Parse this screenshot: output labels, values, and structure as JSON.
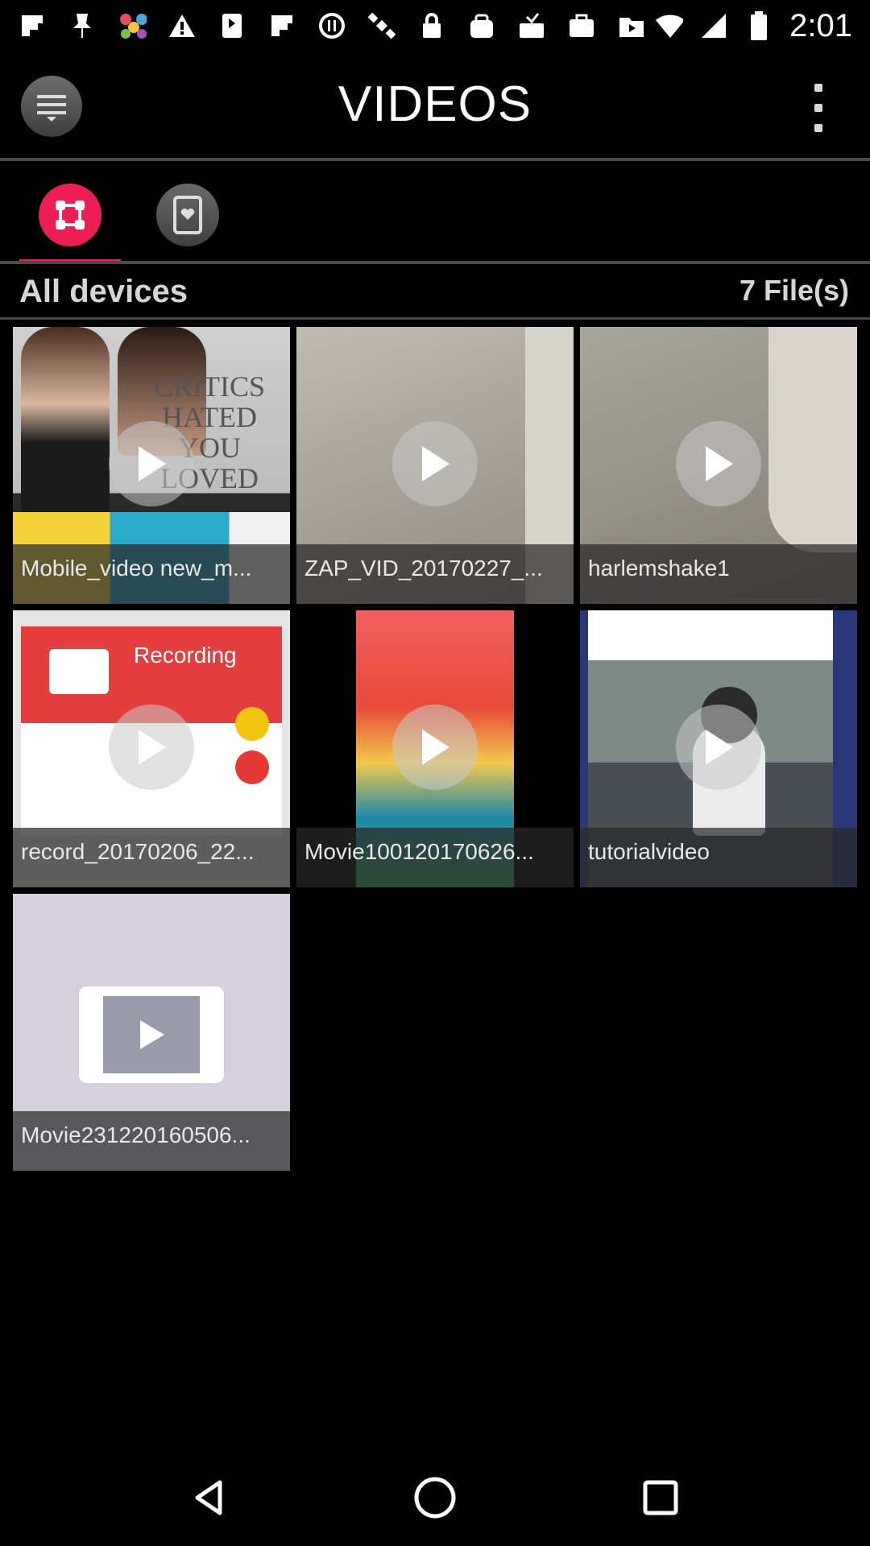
{
  "status_bar": {
    "time": "2:01",
    "icons": [
      "flipboard-icon",
      "pin-icon",
      "photos-icon",
      "warning-icon",
      "app-icon",
      "flipboard-icon",
      "circle-icon",
      "satellite-icon",
      "lock-icon",
      "bag-icon",
      "tray-icon",
      "briefcase-icon",
      "play-store-icon"
    ]
  },
  "header": {
    "title": "VIDEOS",
    "menu_icon": "menu-icon",
    "overflow_icon": "more-vert-icon"
  },
  "tabs": [
    {
      "icon": "devices-network-icon",
      "active": true
    },
    {
      "icon": "favorite-device-icon",
      "active": false
    }
  ],
  "section": {
    "title": "All devices",
    "count": "7 File(s)"
  },
  "videos": [
    {
      "name": "Mobile_video new_m...",
      "thumb_text": "CRITICS HATED YOU LOVED"
    },
    {
      "name": "ZAP_VID_20170227_..."
    },
    {
      "name": "harlemshake1"
    },
    {
      "name": "record_20170206_22...",
      "thumb_text": "Recording"
    },
    {
      "name": "Movie100120170626..."
    },
    {
      "name": "tutorialvideo"
    },
    {
      "name": "Movie231220160506..."
    }
  ],
  "nav_bar": [
    "back-icon",
    "home-icon",
    "recents-icon"
  ],
  "colors": {
    "accent": "#ec1e55",
    "background": "#000000",
    "divider": "#4a4a4a"
  }
}
